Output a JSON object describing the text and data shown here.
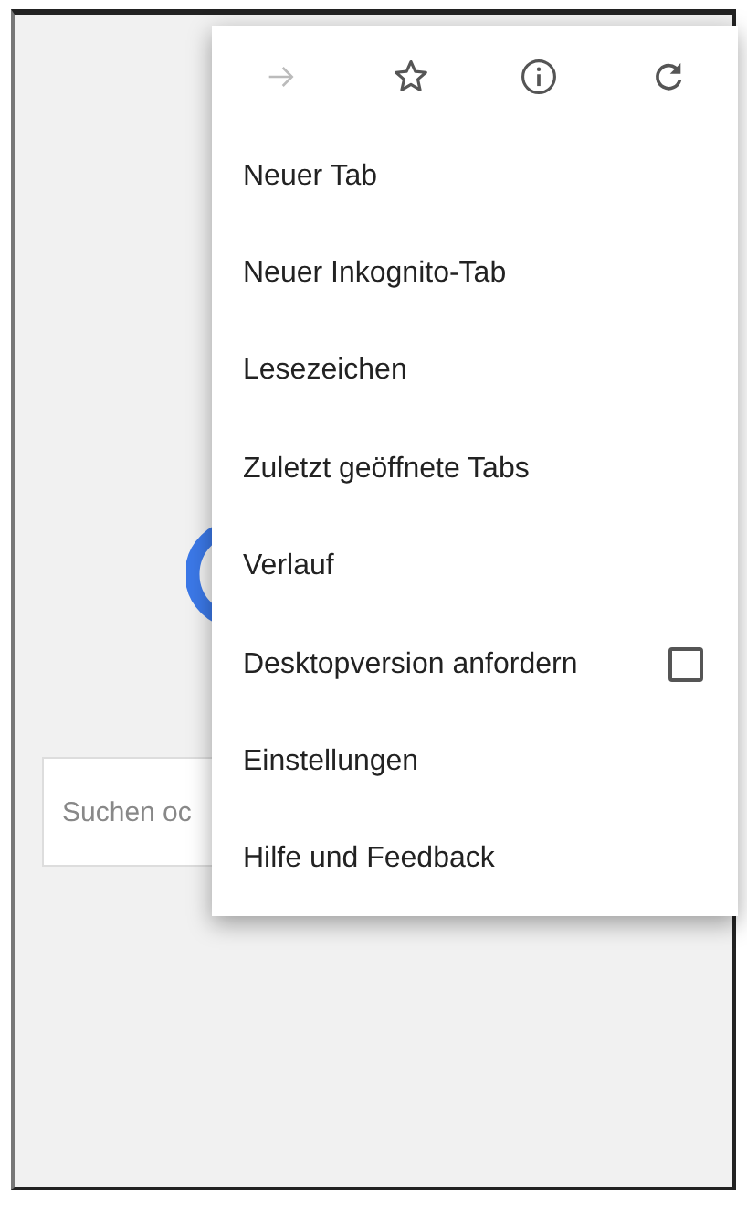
{
  "page": {
    "search": {
      "placeholder": "Suchen oc"
    }
  },
  "menu": {
    "toolbar": [
      {
        "kind": "forward",
        "disabled": true
      },
      {
        "kind": "bookmark",
        "disabled": false
      },
      {
        "kind": "info",
        "disabled": false
      },
      {
        "kind": "reload",
        "disabled": false
      }
    ],
    "items": [
      {
        "kind": "text",
        "label": "Neuer Tab"
      },
      {
        "kind": "text",
        "label": "Neuer Inkognito-Tab"
      },
      {
        "kind": "text",
        "label": "Lesezeichen"
      },
      {
        "kind": "text",
        "label": "Zuletzt geöffnete Tabs"
      },
      {
        "kind": "text",
        "label": "Verlauf"
      },
      {
        "kind": "checkbox",
        "label": "Desktopversion anfordern",
        "checked": false
      },
      {
        "kind": "text",
        "label": "Einstellungen"
      },
      {
        "kind": "text",
        "label": "Hilfe und Feedback"
      }
    ]
  }
}
